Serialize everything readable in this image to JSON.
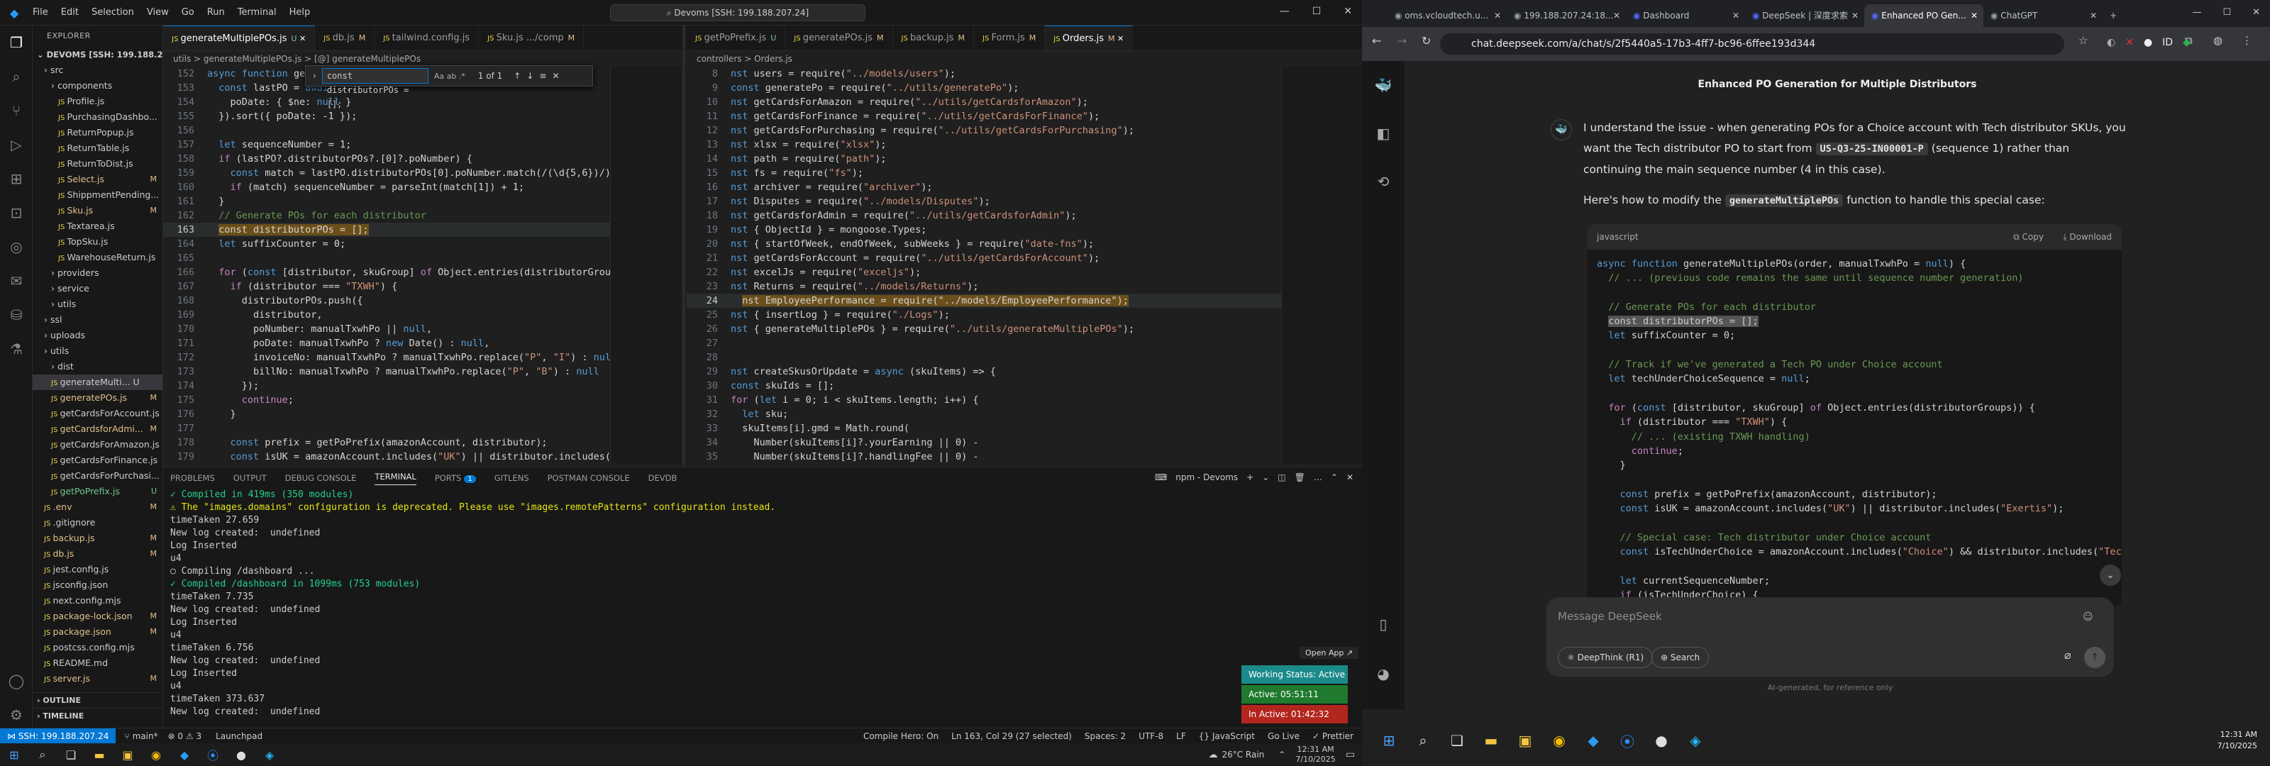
{
  "vscode": {
    "menu": [
      "File",
      "Edit",
      "Selection",
      "View",
      "Go",
      "Run",
      "Terminal",
      "Help"
    ],
    "command_center": "Devoms [SSH: 199.188.207.24]",
    "explorer_title": "EXPLORER",
    "root": "DEVOMS [SSH: 199.188.20...",
    "tree": [
      {
        "label": "src",
        "indent": 1,
        "type": "folder",
        "status": ""
      },
      {
        "label": "components",
        "indent": 2,
        "type": "folder",
        "status": ""
      },
      {
        "label": "Profile.js",
        "indent": 3,
        "type": "file",
        "status": ""
      },
      {
        "label": "PurchasingDashbo...",
        "indent": 3,
        "type": "file",
        "status": ""
      },
      {
        "label": "ReturnPopup.js",
        "indent": 3,
        "type": "file",
        "status": ""
      },
      {
        "label": "ReturnTable.js",
        "indent": 3,
        "type": "file",
        "status": ""
      },
      {
        "label": "ReturnToDist.js",
        "indent": 3,
        "type": "file",
        "status": ""
      },
      {
        "label": "Select.js",
        "indent": 3,
        "type": "file",
        "status": "M"
      },
      {
        "label": "ShippmentPending...",
        "indent": 3,
        "type": "file",
        "status": ""
      },
      {
        "label": "Sku.js",
        "indent": 3,
        "type": "file",
        "status": "M"
      },
      {
        "label": "Textarea.js",
        "indent": 3,
        "type": "file",
        "status": ""
      },
      {
        "label": "TopSku.js",
        "indent": 3,
        "type": "file",
        "status": ""
      },
      {
        "label": "WarehouseReturn.js",
        "indent": 3,
        "type": "file",
        "status": ""
      },
      {
        "label": "providers",
        "indent": 2,
        "type": "folder",
        "status": ""
      },
      {
        "label": "service",
        "indent": 2,
        "type": "folder",
        "status": ""
      },
      {
        "label": "utils",
        "indent": 2,
        "type": "folder",
        "status": ""
      },
      {
        "label": "ssl",
        "indent": 1,
        "type": "folder",
        "status": ""
      },
      {
        "label": "uploads",
        "indent": 1,
        "type": "folder",
        "status": ""
      },
      {
        "label": "utils",
        "indent": 1,
        "type": "folder",
        "status": ""
      },
      {
        "label": "dist",
        "indent": 2,
        "type": "folder",
        "status": ""
      },
      {
        "label": "generateMulti... U",
        "indent": 2,
        "type": "file",
        "status": ""
      },
      {
        "label": "generatePOs.js",
        "indent": 2,
        "type": "file",
        "status": "M"
      },
      {
        "label": "getCardsForAccount.js",
        "indent": 2,
        "type": "file",
        "status": ""
      },
      {
        "label": "getCardsforAdmi...",
        "indent": 2,
        "type": "file",
        "status": "M"
      },
      {
        "label": "getCardsForAmazon.js",
        "indent": 2,
        "type": "file",
        "status": ""
      },
      {
        "label": "getCardsForFinance.js",
        "indent": 2,
        "type": "file",
        "status": ""
      },
      {
        "label": "getCardsForPurchasi...",
        "indent": 2,
        "type": "file",
        "status": ""
      },
      {
        "label": "getPoPrefix.js",
        "indent": 2,
        "type": "file",
        "status": "U"
      },
      {
        "label": ".env",
        "indent": 1,
        "type": "file",
        "status": "M"
      },
      {
        "label": ".gitignore",
        "indent": 1,
        "type": "file",
        "status": ""
      },
      {
        "label": "backup.js",
        "indent": 1,
        "type": "file",
        "status": "M"
      },
      {
        "label": "db.js",
        "indent": 1,
        "type": "file",
        "status": "M"
      },
      {
        "label": "jest.config.js",
        "indent": 1,
        "type": "file",
        "status": ""
      },
      {
        "label": "jsconfig.json",
        "indent": 1,
        "type": "file",
        "status": ""
      },
      {
        "label": "next.config.mjs",
        "indent": 1,
        "type": "file",
        "status": ""
      },
      {
        "label": "package-lock.json",
        "indent": 1,
        "type": "file",
        "status": "M"
      },
      {
        "label": "package.json",
        "indent": 1,
        "type": "file",
        "status": "M"
      },
      {
        "label": "postcss.config.mjs",
        "indent": 1,
        "type": "file",
        "status": ""
      },
      {
        "label": "README.md",
        "indent": 1,
        "type": "file",
        "status": ""
      },
      {
        "label": "server.js",
        "indent": 1,
        "type": "file",
        "status": "M"
      }
    ],
    "outline": "OUTLINE",
    "timeline": "TIMELINE",
    "tabs_left": [
      {
        "label": "generateMultiplePOs.js",
        "st": "U",
        "active": true
      },
      {
        "label": "db.js",
        "st": "M",
        "active": false
      },
      {
        "label": "tailwind.config.js",
        "st": "",
        "active": false
      },
      {
        "label": "Sku.js .../comp",
        "st": "M",
        "active": false
      }
    ],
    "tabs_right": [
      {
        "label": "getPoPrefix.js",
        "st": "U",
        "active": false
      },
      {
        "label": "generatePOs.js",
        "st": "M",
        "active": false
      },
      {
        "label": "backup.js",
        "st": "M",
        "active": false
      },
      {
        "label": "Form.js",
        "st": "M",
        "active": false
      },
      {
        "label": "Orders.js",
        "st": "M",
        "active": true
      }
    ],
    "crumb_left": "utils > generateMultiplePOs.js > [@] generateMultiplePOs",
    "crumb_right": "controllers > Orders.js",
    "find": {
      "value": "const distributorPOs = [];",
      "count": "1 of 1",
      "opts": "Aa ab .*"
    },
    "left_code": [
      {
        "n": "152",
        "t": "async function generateMultiplePOs(order, manualTxwhPo = null) {"
      },
      {
        "n": "153",
        "t": "  const lastPO = await ..."
      },
      {
        "n": "154",
        "t": "    poDate: { $ne: null }"
      },
      {
        "n": "155",
        "t": "  }).sort({ poDate: -1 });"
      },
      {
        "n": "156",
        "t": ""
      },
      {
        "n": "157",
        "t": "  let sequenceNumber = 1;"
      },
      {
        "n": "158",
        "t": "  if (lastPO?.distributorPOs?.[0]?.poNumber) {"
      },
      {
        "n": "159",
        "t": "    const match = lastPO.distributorPOs[0].poNumber.match(/(\\d{5,6})/);"
      },
      {
        "n": "160",
        "t": "    if (match) sequenceNumber = parseInt(match[1]) + 1;"
      },
      {
        "n": "161",
        "t": "  }"
      },
      {
        "n": "162",
        "t": "  // Generate POs for each distributor"
      },
      {
        "n": "163",
        "t": "  const distributorPOs = [];"
      },
      {
        "n": "164",
        "t": "  let suffixCounter = 0;"
      },
      {
        "n": "165",
        "t": ""
      },
      {
        "n": "166",
        "t": "  for (const [distributor, skuGroup] of Object.entries(distributorGroups)) {"
      },
      {
        "n": "167",
        "t": "    if (distributor === \"TXWH\") {"
      },
      {
        "n": "168",
        "t": "      distributorPOs.push({"
      },
      {
        "n": "169",
        "t": "        distributor,"
      },
      {
        "n": "170",
        "t": "        poNumber: manualTxwhPo || null,"
      },
      {
        "n": "171",
        "t": "        poDate: manualTxwhPo ? new Date() : null,"
      },
      {
        "n": "172",
        "t": "        invoiceNo: manualTxwhPo ? manualTxwhPo.replace(\"P\", \"I\") : null,"
      },
      {
        "n": "173",
        "t": "        billNo: manualTxwhPo ? manualTxwhPo.replace(\"P\", \"B\") : null"
      },
      {
        "n": "174",
        "t": "      });"
      },
      {
        "n": "175",
        "t": "      continue;"
      },
      {
        "n": "176",
        "t": "    }"
      },
      {
        "n": "177",
        "t": ""
      },
      {
        "n": "178",
        "t": "    const prefix = getPoPrefix(amazonAccount, distributor);"
      },
      {
        "n": "179",
        "t": "    const isUK = amazonAccount.includes(\"UK\") || distributor.includes(\"E"
      }
    ],
    "right_code": [
      {
        "n": "8",
        "t": "nst users = require(\"../models/users\");"
      },
      {
        "n": "9",
        "t": "const generatePo = require(\"../utils/generatePo\");"
      },
      {
        "n": "10",
        "t": "nst getCardsForAmazon = require(\"../utils/getCardsforAmazon\");"
      },
      {
        "n": "11",
        "t": "nst getCardsForFinance = require(\"../utils/getCardsForFinance\");"
      },
      {
        "n": "12",
        "t": "nst getCardsForPurchasing = require(\"../utils/getCardsForPurchasing\");"
      },
      {
        "n": "13",
        "t": "nst xlsx = require(\"xlsx\");"
      },
      {
        "n": "14",
        "t": "nst path = require(\"path\");"
      },
      {
        "n": "15",
        "t": "nst fs = require(\"fs\");"
      },
      {
        "n": "16",
        "t": "nst archiver = require(\"archiver\");"
      },
      {
        "n": "17",
        "t": "nst Disputes = require(\"../models/Disputes\");"
      },
      {
        "n": "18",
        "t": "nst getCardsforAdmin = require(\"../utils/getCardsforAdmin\");"
      },
      {
        "n": "19",
        "t": "nst { ObjectId } = mongoose.Types;"
      },
      {
        "n": "20",
        "t": "nst { startOfWeek, endOfWeek, subWeeks } = require(\"date-fns\");"
      },
      {
        "n": "21",
        "t": "nst getCardsForAccount = require(\"../utils/getCardsForAccount\");"
      },
      {
        "n": "22",
        "t": "nst excelJs = require(\"exceljs\");"
      },
      {
        "n": "23",
        "t": "nst Returns = require(\"../models/Returns\");"
      },
      {
        "n": "24",
        "t": "nst EmployeePerformance = require(\"../models/EmployeePerformance\");"
      },
      {
        "n": "25",
        "t": "nst { insertLog } = require(\"./Logs\");"
      },
      {
        "n": "26",
        "t": "nst { generateMultiplePOs } = require(\"../utils/generateMultiplePOs\");"
      },
      {
        "n": "27",
        "t": ""
      },
      {
        "n": "28",
        "t": ""
      },
      {
        "n": "29",
        "t": "nst createSkusOrUpdate = async (skuItems) => {"
      },
      {
        "n": "30",
        "t": "const skuIds = [];"
      },
      {
        "n": "31",
        "t": "for (let i = 0; i < skuItems.length; i++) {"
      },
      {
        "n": "32",
        "t": "  let sku;"
      },
      {
        "n": "33",
        "t": "  skuItems[i].gmd = Math.round("
      },
      {
        "n": "34",
        "t": "    Number(skuItems[i]?.yourEarning || 0) -"
      },
      {
        "n": "35",
        "t": "    Number(skuItems[i]?.handlingFee || 0) -"
      },
      {
        "n": "36",
        "t": "    Number(skuItems[i]?.freightCost || 0) -"
      }
    ],
    "panel_tabs": [
      "PROBLEMS",
      "OUTPUT",
      "DEBUG CONSOLE",
      "TERMINAL",
      "PORTS",
      "GITLENS",
      "POSTMAN CONSOLE",
      "DEVDB"
    ],
    "ports_badge": "1",
    "terminal_name": "npm - Devoms",
    "terminal": [
      {
        "t": "✓ Compiled in 419ms (350 modules)",
        "c": "tgreen"
      },
      {
        "t": "⚠ The \"images.domains\" configuration is deprecated. Please use \"images.remotePatterns\" configuration instead.",
        "c": "tyel"
      },
      {
        "t": "timeTaken 27.659",
        "c": ""
      },
      {
        "t": "New log created:  undefined",
        "c": ""
      },
      {
        "t": "Log Inserted",
        "c": ""
      },
      {
        "t": "u4",
        "c": ""
      },
      {
        "t": "○ Compiling /dashboard ...",
        "c": ""
      },
      {
        "t": "✓ Compiled /dashboard in 1099ms (753 modules)",
        "c": "tgreen"
      },
      {
        "t": "timeTaken 7.735",
        "c": ""
      },
      {
        "t": "New log created:  undefined",
        "c": ""
      },
      {
        "t": "Log Inserted",
        "c": ""
      },
      {
        "t": "u4",
        "c": ""
      },
      {
        "t": "timeTaken 6.756",
        "c": ""
      },
      {
        "t": "New log created:  undefined",
        "c": ""
      },
      {
        "t": "Log Inserted",
        "c": ""
      },
      {
        "t": "u4",
        "c": ""
      },
      {
        "t": "timeTaken 373.637",
        "c": ""
      },
      {
        "t": "New log created:  undefined",
        "c": ""
      }
    ],
    "open_app": "Open App ↗",
    "working_status": "Working Status: Active",
    "active_time": "Active: 05:51:11",
    "inactive_time": "In Active: 01:42:32",
    "status_remote": "SSH: 199.188.207.24",
    "status_branch": "main*",
    "status_errors": "⊗ 0 ⚠ 3",
    "status_compile": "Compile Hero: On",
    "status_pos": "Ln 163, Col 29 (27 selected)",
    "status_spaces": "Spaces: 2",
    "status_enc": "UTF-8",
    "status_eol": "LF",
    "status_lang": "{} JavaScript",
    "status_golive": "Go Live",
    "status_prettier": "✓ Prettier",
    "status_launchpad": "Launchpad",
    "weather": "26°C Rain",
    "clock_time": "12:31 AM",
    "clock_date": "7/10/2025"
  },
  "chrome": {
    "tabs": [
      {
        "label": "oms.vcloudtech.u..."
      },
      {
        "label": "199.188.207.24:18..."
      },
      {
        "label": "Dashboard"
      },
      {
        "label": "DeepSeek | 深度求索"
      },
      {
        "label": "Enhanced PO Gen..."
      },
      {
        "label": "ChatGPT"
      }
    ],
    "active_tab": 4,
    "url": "chat.deepseek.com/a/chat/s/2f5440a5-17b3-4ff7-bc96-6ffee193d344",
    "chat_title": "Enhanced PO Generation for Multiple Distributors",
    "intro_1": "I understand the issue - when generating POs for a Choice account with Tech distributor SKUs, you want the Tech distributor PO to start from",
    "intro_code": "US-Q3-25-IN00001-P",
    "intro_2": "(sequence 1) rather than continuing the main sequence number (4 in this case).",
    "howto_1": "Here's how to modify the",
    "howto_code": "generateMultiplePOs",
    "howto_2": "function to handle this special case:",
    "code_lang": "javascript",
    "copy": "Copy",
    "download": "Download",
    "code": [
      "async function generateMultiplePOs(order, manualTxwhPo = null) {",
      "  // ... (previous code remains the same until sequence number generation)",
      "",
      "  // Generate POs for each distributor",
      "  const distributorPOs = [];",
      "  let suffixCounter = 0;",
      "",
      "  // Track if we've generated a Tech PO under Choice account",
      "  let techUnderChoiceSequence = null;",
      "",
      "  for (const [distributor, skuGroup] of Object.entries(distributorGroups)) {",
      "    if (distributor === \"TXWH\") {",
      "      // ... (existing TXWH handling)",
      "      continue;",
      "    }",
      "",
      "    const prefix = getPoPrefix(amazonAccount, distributor);",
      "    const isUK = amazonAccount.includes(\"UK\") || distributor.includes(\"Exertis\");",
      "",
      "    // Special case: Tech distributor under Choice account",
      "    const isTechUnderChoice = amazonAccount.includes(\"Choice\") && distributor.includes(\"Tech\");",
      "",
      "    let currentSequenceNumber;",
      "    if (isTechUnderChoice) {"
    ],
    "message_placeholder": "Message DeepSeek",
    "deepthink": "DeepThink (R1)",
    "search": "Search",
    "disclaimer": "AI-generated, for reference only",
    "clock_time": "12:31 AM",
    "clock_date": "7/10/2025"
  }
}
